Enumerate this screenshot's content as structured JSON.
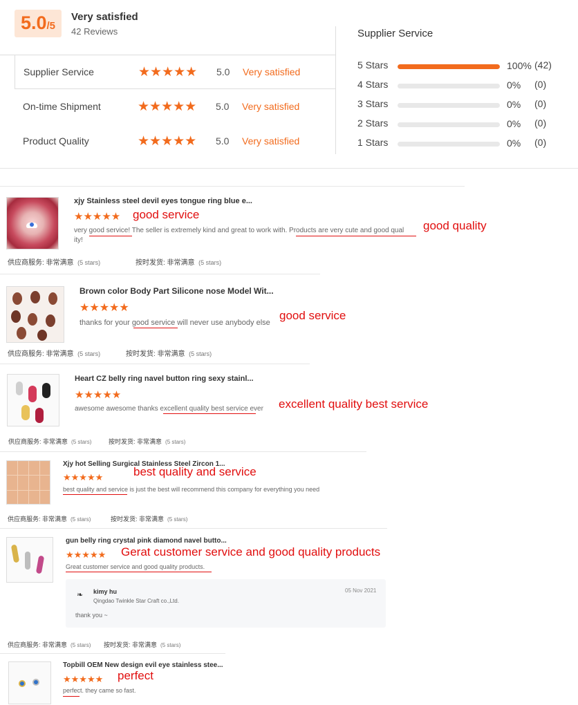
{
  "summary": {
    "score": "5.0",
    "score_max": "/5",
    "rating_text": "Very satisfied",
    "review_count": "42 Reviews",
    "categories": [
      {
        "label": "Supplier Service",
        "stars": "★★★★★",
        "value": "5.0",
        "text": "Very satisfied"
      },
      {
        "label": "On-time Shipment",
        "stars": "★★★★★",
        "value": "5.0",
        "text": "Very satisfied"
      },
      {
        "label": "Product Quality",
        "stars": "★★★★★",
        "value": "5.0",
        "text": "Very satisfied"
      }
    ]
  },
  "breakdown": {
    "title": "Supplier Service",
    "rows": [
      {
        "label": "5  Stars",
        "fraction": 1.0,
        "pct": "100%",
        "count": "(42)"
      },
      {
        "label": "4  Stars",
        "fraction": 0.0,
        "pct": "0%",
        "count": "(0)"
      },
      {
        "label": "3  Stars",
        "fraction": 0.0,
        "pct": "0%",
        "count": "(0)"
      },
      {
        "label": "2  Stars",
        "fraction": 0.0,
        "pct": "0%",
        "count": "(0)"
      },
      {
        "label": "1  Stars",
        "fraction": 0.0,
        "pct": "0%",
        "count": "(0)"
      }
    ]
  },
  "reviews": [
    {
      "title": "xjy Stainless steel devil eyes tongue ring blue e...",
      "stars": "★★★★★",
      "body_line1": "very good service! The seller is extremely kind and great to work with. Products are very cute and good qual",
      "body_line2": "ity!",
      "annotation": "good service",
      "annotation2": "good quality",
      "meta_label1": "供应商服务: 非常满意",
      "meta_stars1": "(5 stars)",
      "meta_label2": "按时发货: 非常满意",
      "meta_stars2": "(5 stars)"
    },
    {
      "title": "Brown color Body Part Silicone nose Model Wit...",
      "stars": "★★★★★",
      "body_line1": "thanks for your good service will never use anybody else",
      "annotation": "good service",
      "meta_label1": "供应商服务: 非常满意",
      "meta_stars1": "(5 stars)",
      "meta_label2": "按时发货: 非常满意",
      "meta_stars2": "(5 stars)"
    },
    {
      "title": "Heart CZ belly ring navel button ring sexy stainl...",
      "stars": "★★★★★",
      "body_line1": "awesome awesome thanks excellent quality best service ever",
      "annotation": "excellent quality best service",
      "meta_label1": "供应商服务: 非常满意",
      "meta_stars1": "(5 stars)",
      "meta_label2": "按时发货: 非常满意",
      "meta_stars2": "(5 stars)"
    },
    {
      "title": "Xjy hot Selling Surgical Stainless Steel Zircon 1...",
      "stars": "★★★★★",
      "body_line1": "best quality and service is just the best will recommend this company for everything you need",
      "annotation": "best quality and service",
      "meta_label1": "供应商服务: 非常满意",
      "meta_stars1": "(5 stars)",
      "meta_label2": "按时发货: 非常满意",
      "meta_stars2": "(5 stars)"
    },
    {
      "title": "gun belly ring crystal pink diamond navel butto...",
      "stars": "★★★★★",
      "body_line1": "Great customer service and good quality products.",
      "annotation": "Gerat customer service and good quality products",
      "reply": {
        "name": "kimy hu",
        "company": "Qingdao Twinkle Star Craft co.,Ltd.",
        "date": "05 Nov 2021",
        "text": "thank you ~"
      },
      "meta_label1": "供应商服务: 非常满意",
      "meta_stars1": "(5 stars)",
      "meta_label2": "按时发货: 非常满意",
      "meta_stars2": "(5 stars)"
    },
    {
      "title": "Topbill OEM New design evil eye stainless stee...",
      "stars": "★★★★★",
      "body_line1": "perfect. they came so fast.",
      "annotation": "perfect"
    }
  ],
  "colors": {
    "accent": "#f26b1d",
    "annotation": "#e10e0e",
    "score_bg": "#fde6d6"
  }
}
